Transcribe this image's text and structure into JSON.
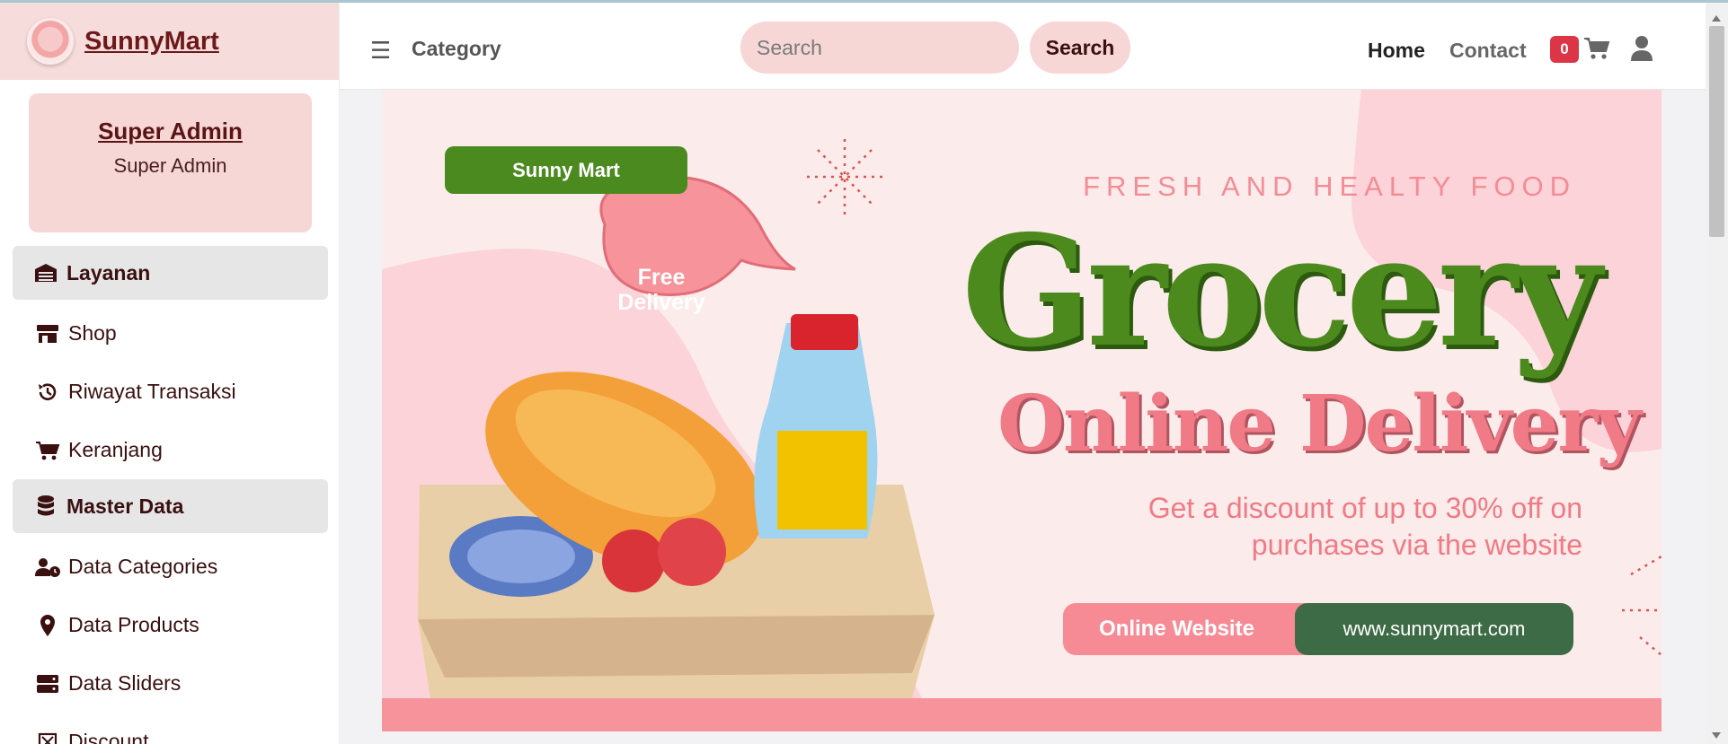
{
  "brand": {
    "name": "SunnyMart"
  },
  "profile": {
    "name": "Super Admin",
    "role": "Super Admin"
  },
  "sidebar": {
    "sections": [
      {
        "heading": "Layanan",
        "heading_icon": "layanan-icon",
        "items": [
          {
            "label": "Shop",
            "icon": "shop-icon"
          },
          {
            "label": "Riwayat Transaksi",
            "icon": "history-icon"
          },
          {
            "label": "Keranjang",
            "icon": "cart-icon"
          }
        ]
      },
      {
        "heading": "Master Data",
        "heading_icon": "database-icon",
        "items": [
          {
            "label": "Data Categories",
            "icon": "user-clock-icon"
          },
          {
            "label": "Data Products",
            "icon": "map-pin-icon"
          },
          {
            "label": "Data Sliders",
            "icon": "server-icon"
          },
          {
            "label": "Discount",
            "icon": "discount-icon"
          }
        ]
      }
    ]
  },
  "header": {
    "category": "Category",
    "search_placeholder": "Search",
    "search_button": "Search",
    "nav": {
      "home": "Home",
      "contact": "Contact"
    },
    "cart_count": "0"
  },
  "banner": {
    "tag": "Sunny Mart",
    "subtitle": "FRESH AND HEALTY FOOD",
    "title": "Grocery",
    "title2": "Online Delivery",
    "discount_line1": "Get a discount of up to 30% off on",
    "discount_line2": "purchases via the website",
    "pill_label": "Online Website",
    "pill_url": "www.sunnymart.com",
    "bubble_line1": "Free",
    "bubble_line2": "Delivery"
  },
  "colors": {
    "brand_pink": "#f7dcdc",
    "accent_green": "#4a8a1f",
    "accent_pink": "#f07a85",
    "badge_red": "#dc3545"
  }
}
